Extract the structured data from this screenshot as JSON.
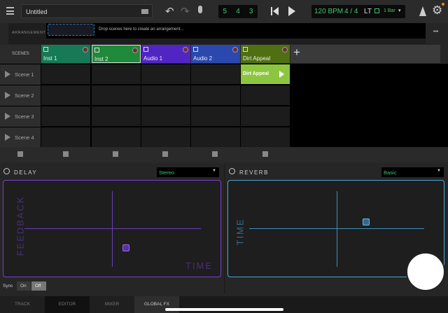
{
  "toolbar": {
    "title": "Untitled",
    "position": [
      "5",
      "4",
      "3"
    ],
    "tempo": "120 BPM",
    "time_signature": "4 / 4",
    "lt": "LT",
    "quantize": "1 Bar"
  },
  "arrangement": {
    "label": "ARRANGEMENT",
    "hint": "Drop scenes here to create an arrangement...",
    "more": "•••"
  },
  "scenes_label": "SCENES",
  "tracks": [
    {
      "name": "Inst 1",
      "color": "#157a55",
      "icon": "piano-icon"
    },
    {
      "name": "Inst 2",
      "color": "#1f8a3a",
      "icon": "piano-icon",
      "selected": true
    },
    {
      "name": "Audio 1",
      "color": "#5125c4",
      "icon": "waveform-icon"
    },
    {
      "name": "Audio 2",
      "color": "#2a48ae",
      "icon": "waveform-icon"
    },
    {
      "name": "Dirt Appeal",
      "color": "#4f6f12",
      "icon": "piano-icon"
    }
  ],
  "scenes": [
    "Scene 1",
    "Scene 2",
    "Scene 3",
    "Scene 4"
  ],
  "clip": {
    "name": "Dirt Appeal",
    "color": "#8cc63f"
  },
  "fx": {
    "delay": {
      "title": "DELAY",
      "mode": "Stereo",
      "y_label": "FEEDBACK",
      "x_label": "TIME",
      "color": "#7b3fd0"
    },
    "reverb": {
      "title": "REVERB",
      "mode": "Basic",
      "y_label": "TIME",
      "color": "#4aa6d0"
    }
  },
  "sync": {
    "label": "Sync",
    "on": "On",
    "off": "Off",
    "active": "Off"
  },
  "tabs": [
    "TRACK",
    "EDITOR",
    "MIXER",
    "GLOBAL FX"
  ],
  "active_tab": "GLOBAL FX"
}
